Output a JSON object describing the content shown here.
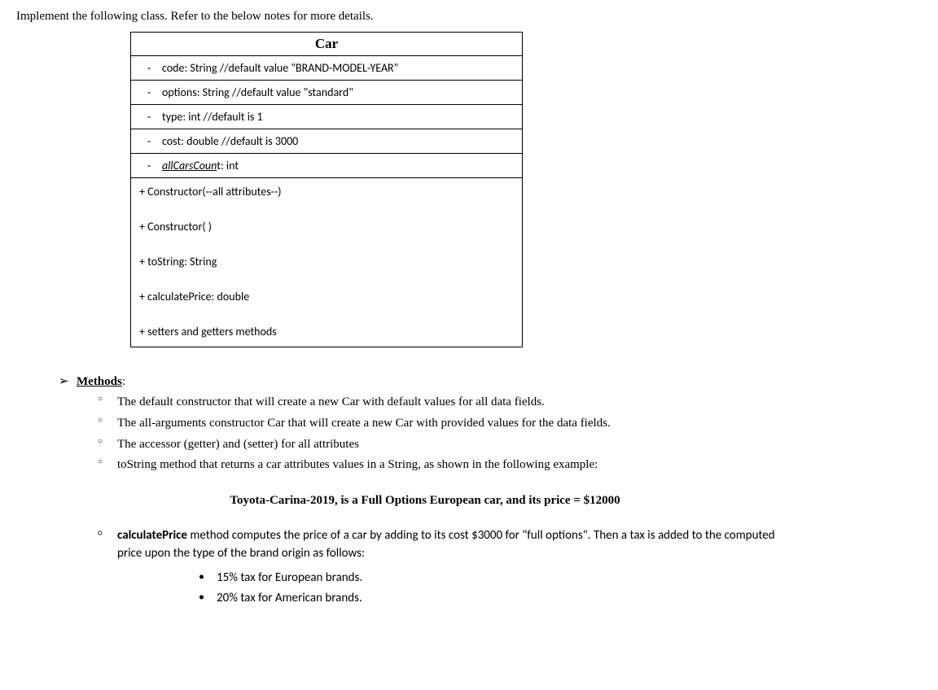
{
  "intro": "Implement the following class. Refer to the below notes for more details.",
  "uml": {
    "title": "Car",
    "attributes": [
      {
        "text": "code: String //default value \"BRAND-MODEL-YEAR\""
      },
      {
        "text": "options: String //default value \"standard\""
      },
      {
        "text": "type: int //default is 1"
      },
      {
        "text": "cost: double //default is 3000"
      },
      {
        "underlined": "allCarsCoun",
        "rest": "t: int"
      }
    ],
    "methods": [
      "+ Constructor(--all attributes--)",
      "+ Constructor( )",
      "+ toString: String",
      "+ calculatePrice: double",
      "+ setters and getters methods"
    ]
  },
  "methodsHeading": "Methods",
  "methodsList": [
    "The default constructor that will create a new Car with default values for all data fields.",
    "The all-arguments constructor Car that will create a new Car with provided values for the data fields.",
    "The accessor (getter) and (setter) for all attributes",
    "toString method that returns a car attributes values in a String, as shown in the following example:"
  ],
  "example": "Toyota-Carina-2019, is a Full Options European car, and its price = $12000",
  "calcPrice": {
    "boldLead": "calculatePrice",
    "rest": " method computes the price of a car by adding to its cost $3000 for \"full options\". Then a tax is added to the computed price upon the type of the brand origin as follows:"
  },
  "taxes": [
    "15% tax for European brands.",
    "20% tax for American brands."
  ]
}
